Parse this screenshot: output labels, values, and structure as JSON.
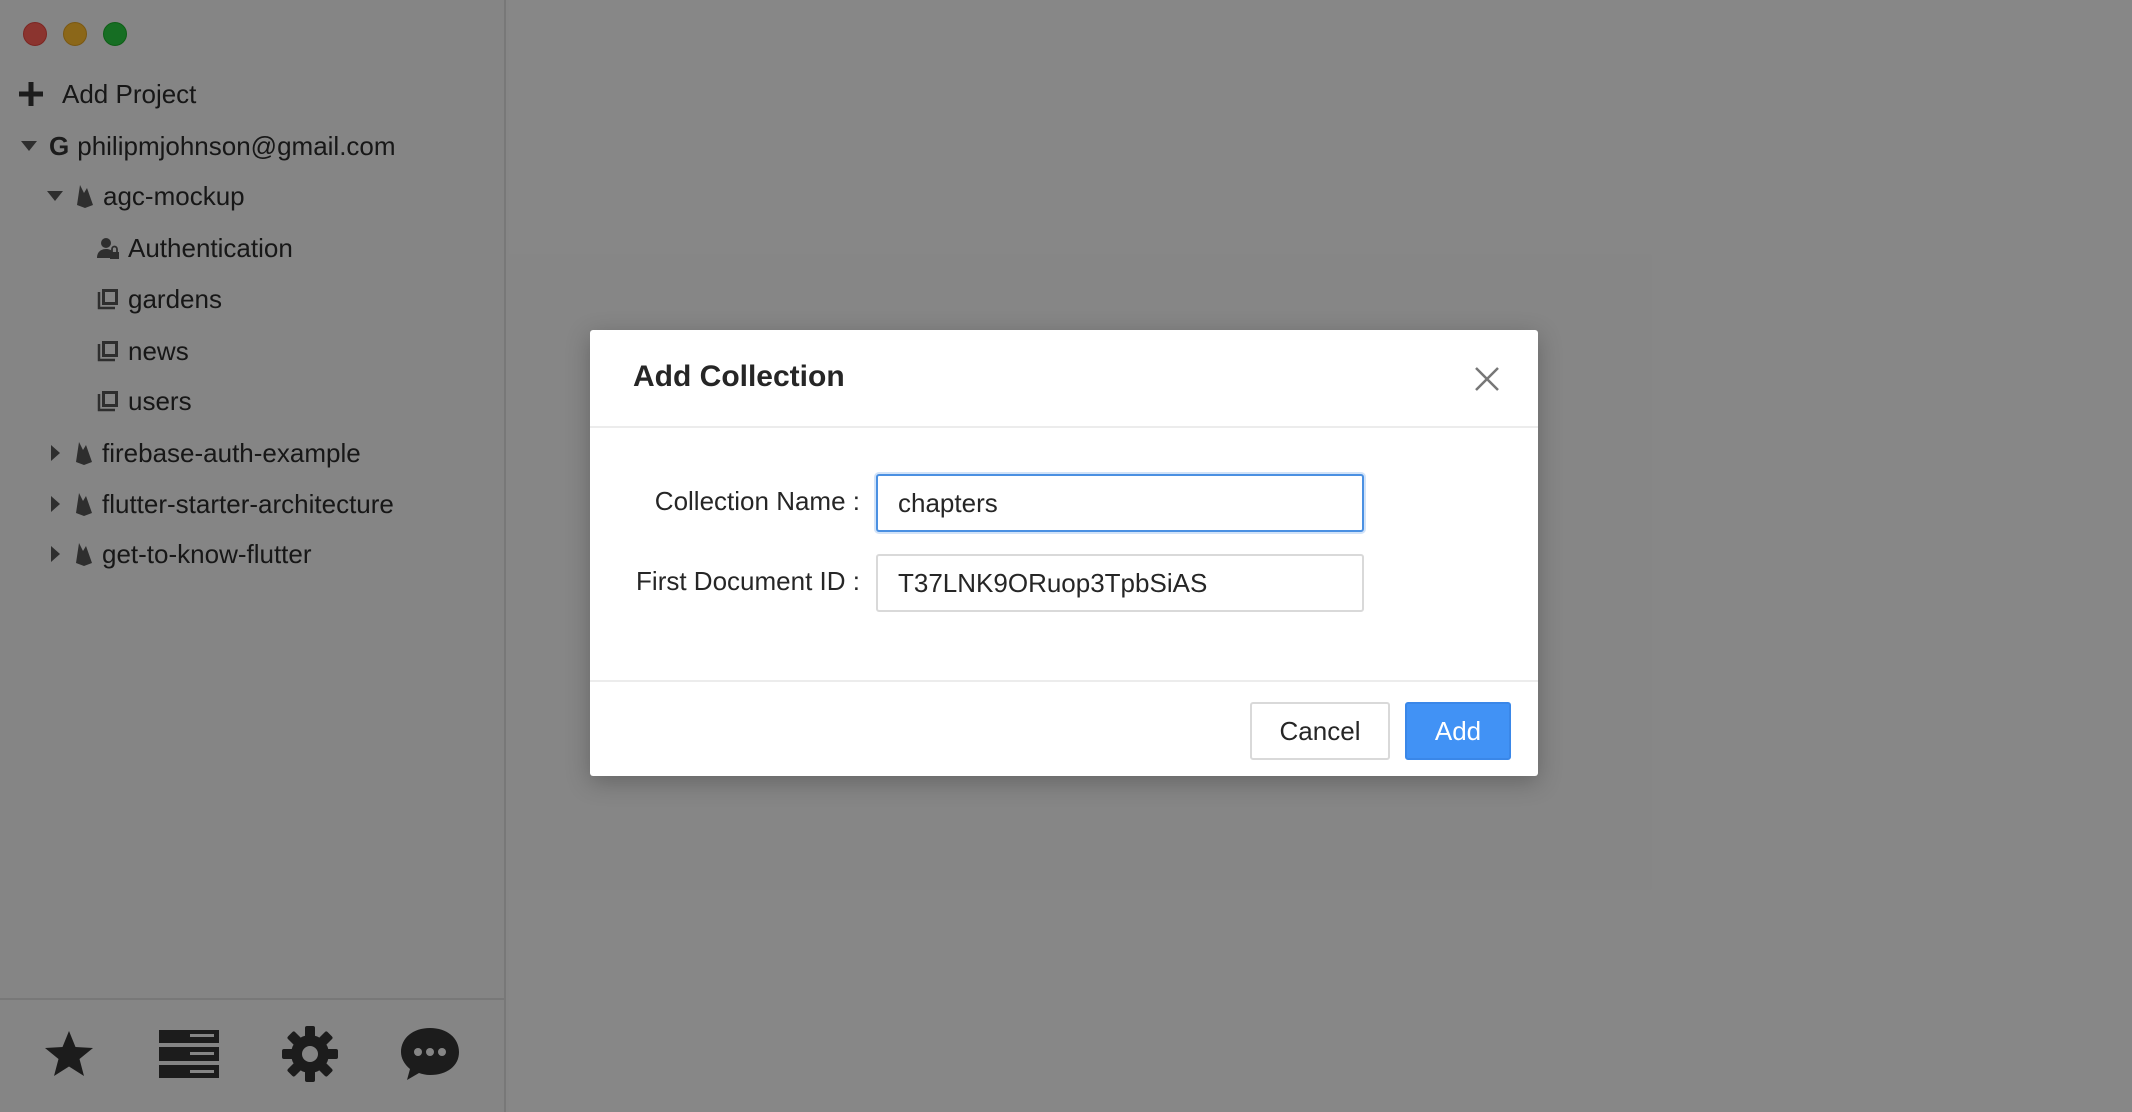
{
  "sidebar": {
    "add_project_label": "Add Project",
    "account": {
      "badge": "G",
      "email": "philipmjohnson@gmail.com"
    },
    "projects": [
      {
        "name": "agc-mockup",
        "expanded": true,
        "children": [
          {
            "label": "Authentication",
            "icon": "user-lock-icon"
          },
          {
            "label": "gardens",
            "icon": "collection-icon"
          },
          {
            "label": "news",
            "icon": "collection-icon"
          },
          {
            "label": "users",
            "icon": "collection-icon"
          }
        ]
      },
      {
        "name": "firebase-auth-example",
        "expanded": false
      },
      {
        "name": "flutter-starter-architecture",
        "expanded": false
      },
      {
        "name": "get-to-know-flutter",
        "expanded": false
      }
    ],
    "bottom_icons": [
      "star-icon",
      "server-icon",
      "gear-icon",
      "chat-icon"
    ]
  },
  "dialog": {
    "title": "Add Collection",
    "collection_name_label": "Collection Name",
    "collection_name_value": "chapters",
    "first_document_id_label": "First Document ID",
    "first_document_id_value": "T37LNK9ORuop3TpbSiAS",
    "cancel_label": "Cancel",
    "add_label": "Add"
  },
  "colors": {
    "primary": "#4192f5",
    "focus_border": "#4a90e2",
    "traffic_close": "#fe5f57",
    "traffic_min": "#febc2e",
    "traffic_max": "#28c840"
  }
}
